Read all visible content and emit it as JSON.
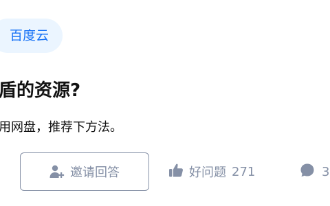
{
  "topic": {
    "label": "百度云"
  },
  "question": {
    "title": "盾的资源?",
    "detail": "用网盘，推荐下方法。"
  },
  "actions": {
    "invite_label": "邀请回答",
    "good_question_label": "好问题",
    "good_question_count": "271",
    "comment_count": "3"
  },
  "icons": {
    "invite": "add-person-icon",
    "good_question": "thumbs-up-icon",
    "comment": "comment-bubble-icon"
  },
  "colors": {
    "tag_text": "#1772f6",
    "tag_background": "#ebf5ff",
    "secondary_text": "#8590a6",
    "primary_text": "#121212"
  }
}
